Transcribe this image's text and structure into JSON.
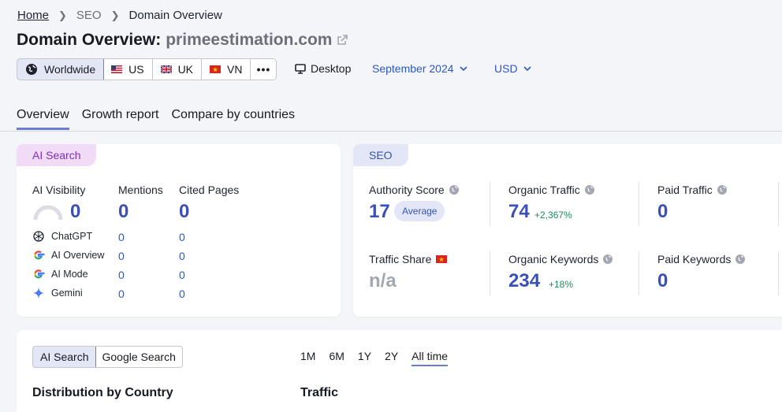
{
  "breadcrumb": {
    "home": "Home",
    "seo": "SEO",
    "current": "Domain Overview"
  },
  "title": {
    "prefix": "Domain Overview:",
    "domain": "primeestimation.com"
  },
  "regions": [
    {
      "label": "Worldwide",
      "icon": "globe-icon"
    },
    {
      "label": "US",
      "icon": "us-flag-icon"
    },
    {
      "label": "UK",
      "icon": "uk-flag-icon"
    },
    {
      "label": "VN",
      "icon": "vn-flag-icon"
    }
  ],
  "more_label": "•••",
  "device": "Desktop",
  "date": "September 2024",
  "currency": "USD",
  "tabs": [
    "Overview",
    "Growth report",
    "Compare by countries"
  ],
  "ai": {
    "pill": "AI Search",
    "cols": [
      "AI Visibility",
      "Mentions",
      "Cited Pages"
    ],
    "totals": [
      "0",
      "0",
      "0"
    ],
    "sources": [
      {
        "name": "ChatGPT",
        "icon": "chatgpt-icon",
        "mentions": "0",
        "cited": "0"
      },
      {
        "name": "AI Overview",
        "icon": "google-icon",
        "mentions": "0",
        "cited": "0"
      },
      {
        "name": "AI Mode",
        "icon": "google-icon",
        "mentions": "0",
        "cited": "0"
      },
      {
        "name": "Gemini",
        "icon": "gemini-icon",
        "mentions": "0",
        "cited": "0"
      }
    ]
  },
  "seo": {
    "pill": "SEO",
    "authority_label": "Authority Score",
    "authority_value": "17",
    "authority_badge": "Average",
    "organic_traffic_label": "Organic Traffic",
    "organic_traffic_value": "74",
    "organic_traffic_change": "+2,367%",
    "paid_traffic_label": "Paid Traffic",
    "paid_traffic_value": "0",
    "traffic_share_label": "Traffic Share",
    "traffic_share_value": "n/a",
    "organic_keywords_label": "Organic Keywords",
    "organic_keywords_value": "234",
    "organic_keywords_change": "+18%",
    "paid_keywords_label": "Paid Keywords",
    "paid_keywords_value": "0"
  },
  "bottom": {
    "toggle": [
      "AI Search",
      "Google Search"
    ],
    "ranges": [
      "1M",
      "6M",
      "1Y",
      "2Y",
      "All time"
    ],
    "distribution_title": "Distribution by Country",
    "traffic_title": "Traffic"
  },
  "colors": {
    "accent": "#3a50b5",
    "ai_pill_bg": "#f1dbf7",
    "seo_pill_bg": "#e2e6f7",
    "positive": "#1d8c5a"
  }
}
